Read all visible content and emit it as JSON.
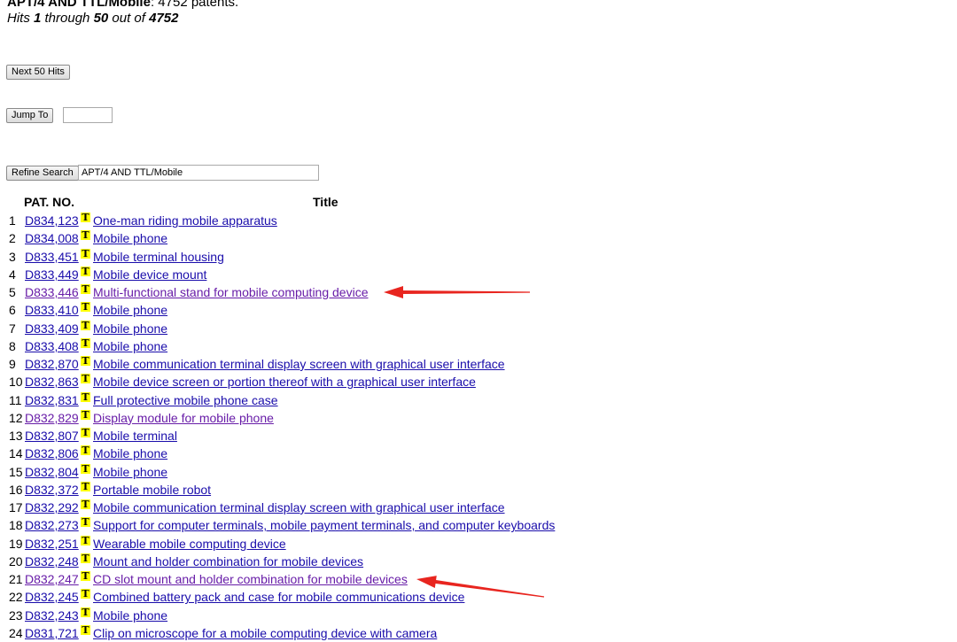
{
  "header": {
    "query_bold": "APT/4 AND TTL/Mobile",
    "query_suffix": ": 4752 patents.",
    "hits_prefix": "Hits ",
    "hits_from": "1",
    "hits_mid": " through ",
    "hits_to": "50",
    "hits_out": " out of ",
    "hits_total": "4752"
  },
  "controls": {
    "next_label": "Next 50 Hits",
    "jump_label": "Jump To",
    "jump_value": "",
    "refine_label": "Refine Search",
    "refine_value": "APT/4 AND TTL/Mobile"
  },
  "table": {
    "col_pat": "PAT. NO.",
    "col_title": "Title",
    "icon_letter": "T",
    "rows": [
      {
        "n": "1",
        "pat": "D834,123",
        "title": "One-man riding mobile apparatus",
        "visited": false
      },
      {
        "n": "2",
        "pat": "D834,008",
        "title": "Mobile phone",
        "visited": false
      },
      {
        "n": "3",
        "pat": "D833,451",
        "title": "Mobile terminal housing",
        "visited": false
      },
      {
        "n": "4",
        "pat": "D833,449",
        "title": "Mobile device mount",
        "visited": false
      },
      {
        "n": "5",
        "pat": "D833,446",
        "title": "Multi-functional stand for mobile computing device",
        "visited": true
      },
      {
        "n": "6",
        "pat": "D833,410",
        "title": "Mobile phone",
        "visited": false
      },
      {
        "n": "7",
        "pat": "D833,409",
        "title": "Mobile phone",
        "visited": false
      },
      {
        "n": "8",
        "pat": "D833,408",
        "title": "Mobile phone",
        "visited": false
      },
      {
        "n": "9",
        "pat": "D832,870",
        "title": "Mobile communication terminal display screen with graphical user interface",
        "visited": false
      },
      {
        "n": "10",
        "pat": "D832,863",
        "title": "Mobile device screen or portion thereof with a graphical user interface",
        "visited": false
      },
      {
        "n": "11",
        "pat": "D832,831",
        "title": "Full protective mobile phone case",
        "visited": false
      },
      {
        "n": "12",
        "pat": "D832,829",
        "title": "Display module for mobile phone",
        "visited": true
      },
      {
        "n": "13",
        "pat": "D832,807",
        "title": "Mobile terminal",
        "visited": false
      },
      {
        "n": "14",
        "pat": "D832,806",
        "title": "Mobile phone",
        "visited": false
      },
      {
        "n": "15",
        "pat": "D832,804",
        "title": "Mobile phone",
        "visited": false
      },
      {
        "n": "16",
        "pat": "D832,372",
        "title": "Portable mobile robot",
        "visited": false
      },
      {
        "n": "17",
        "pat": "D832,292",
        "title": "Mobile communication terminal display screen with graphical user interface",
        "visited": false
      },
      {
        "n": "18",
        "pat": "D832,273",
        "title": "Support for computer terminals, mobile payment terminals, and computer keyboards",
        "visited": false
      },
      {
        "n": "19",
        "pat": "D832,251",
        "title": "Wearable mobile computing device",
        "visited": false
      },
      {
        "n": "20",
        "pat": "D832,248",
        "title": "Mount and holder combination for mobile devices",
        "visited": false
      },
      {
        "n": "21",
        "pat": "D832,247",
        "title": "CD slot mount and holder combination for mobile devices",
        "visited": true
      },
      {
        "n": "22",
        "pat": "D832,245",
        "title": "Combined battery pack and case for mobile communications device",
        "visited": false
      },
      {
        "n": "23",
        "pat": "D832,243",
        "title": "Mobile phone",
        "visited": false
      },
      {
        "n": "24",
        "pat": "D831,721",
        "title": "Clip on microscope for a mobile computing device with camera",
        "visited": false
      }
    ]
  },
  "annotation_color": "#e8251f"
}
